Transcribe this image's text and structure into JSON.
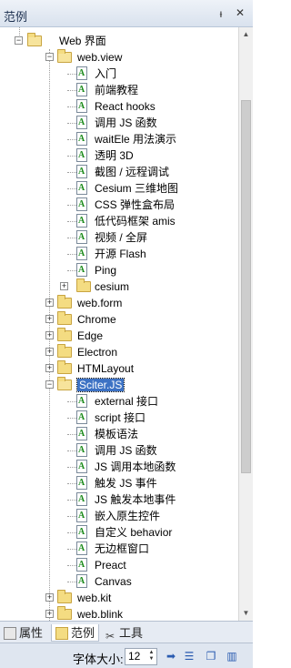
{
  "panel": {
    "title": "范例",
    "pin_glyph": "ᵼ",
    "close_glyph": "✕"
  },
  "tree": {
    "items": [
      {
        "label": "Web 界面",
        "type": "folder",
        "level": 0,
        "expanded": true
      },
      {
        "label": "web.view",
        "type": "folder",
        "level": 1,
        "expanded": true
      },
      {
        "label": "入门",
        "type": "doc",
        "level": 2
      },
      {
        "label": "前端教程",
        "type": "doc",
        "level": 2
      },
      {
        "label": "React hooks",
        "type": "doc",
        "level": 2
      },
      {
        "label": "调用 JS 函数",
        "type": "doc",
        "level": 2
      },
      {
        "label": "waitEle 用法演示",
        "type": "doc",
        "level": 2
      },
      {
        "label": "透明 3D",
        "type": "doc",
        "level": 2
      },
      {
        "label": "截图 / 远程调试",
        "type": "doc",
        "level": 2
      },
      {
        "label": "Cesium 三维地图",
        "type": "doc",
        "level": 2
      },
      {
        "label": "CSS 弹性盒布局",
        "type": "doc",
        "level": 2
      },
      {
        "label": "低代码框架 amis",
        "type": "doc",
        "level": 2
      },
      {
        "label": "视频 / 全屏",
        "type": "doc",
        "level": 2
      },
      {
        "label": "开源 Flash",
        "type": "doc",
        "level": 2
      },
      {
        "label": "Ping",
        "type": "doc",
        "level": 2
      },
      {
        "label": "cesium",
        "type": "folder",
        "level": 2,
        "expanded": false
      },
      {
        "label": "web.form",
        "type": "folder",
        "level": 1,
        "expanded": false
      },
      {
        "label": "Chrome",
        "type": "folder",
        "level": 1,
        "expanded": false
      },
      {
        "label": "Edge",
        "type": "folder",
        "level": 1,
        "expanded": false
      },
      {
        "label": "Electron",
        "type": "folder",
        "level": 1,
        "expanded": false
      },
      {
        "label": "HTMLayout",
        "type": "folder",
        "level": 1,
        "expanded": false
      },
      {
        "label": "Sciter.JS",
        "type": "folder",
        "level": 1,
        "expanded": true,
        "selected": true
      },
      {
        "label": "external 接口",
        "type": "doc",
        "level": 2
      },
      {
        "label": "script 接口",
        "type": "doc",
        "level": 2
      },
      {
        "label": "模板语法",
        "type": "doc",
        "level": 2
      },
      {
        "label": "调用 JS 函数",
        "type": "doc",
        "level": 2
      },
      {
        "label": "JS 调用本地函数",
        "type": "doc",
        "level": 2
      },
      {
        "label": "触发 JS 事件",
        "type": "doc",
        "level": 2
      },
      {
        "label": "JS 触发本地事件",
        "type": "doc",
        "level": 2
      },
      {
        "label": "嵌入原生控件",
        "type": "doc",
        "level": 2
      },
      {
        "label": "自定义 behavior",
        "type": "doc",
        "level": 2
      },
      {
        "label": "无边框窗口",
        "type": "doc",
        "level": 2
      },
      {
        "label": "Preact",
        "type": "doc",
        "level": 2
      },
      {
        "label": "Canvas",
        "type": "doc",
        "level": 2
      },
      {
        "label": "web.kit",
        "type": "folder",
        "level": 1,
        "expanded": false
      },
      {
        "label": "web.blink",
        "type": "folder",
        "level": 1,
        "expanded": false
      }
    ]
  },
  "tabs": [
    {
      "label": "属性",
      "icon": "property-icon",
      "active": false
    },
    {
      "label": "范例",
      "icon": "examples-icon",
      "active": true
    },
    {
      "label": "工具",
      "icon": "tools-icon",
      "active": false
    }
  ],
  "footer": {
    "font_size_label": "字体大小:",
    "font_size_value": "12",
    "buttons": [
      {
        "name": "go-arrow-icon",
        "glyph": "➡"
      },
      {
        "name": "list-icon",
        "glyph": "☰"
      },
      {
        "name": "book-icon",
        "glyph": "❐"
      },
      {
        "name": "panel-icon",
        "glyph": "▥"
      }
    ]
  }
}
